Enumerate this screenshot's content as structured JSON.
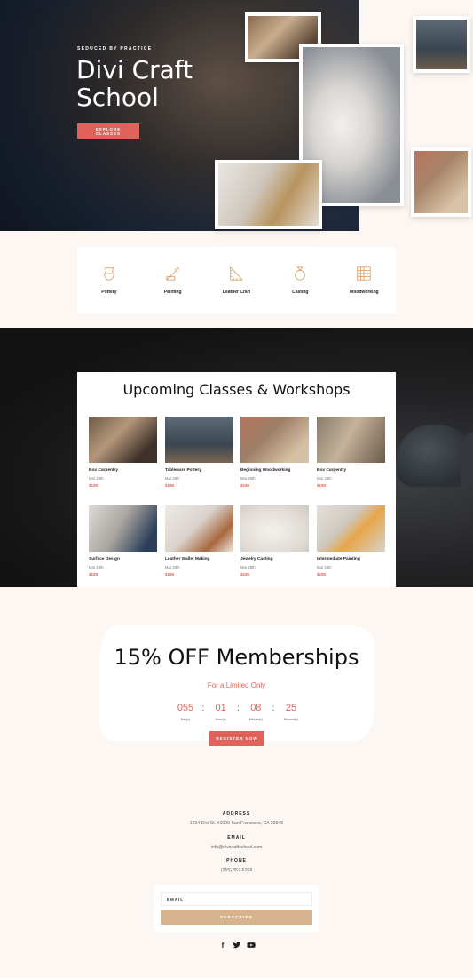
{
  "hero": {
    "kicker": "SEDUCED BY PRACTICE",
    "title": "Divi Craft School",
    "button": "EXPLORE CLASSES"
  },
  "categories": [
    {
      "label": "Pottery",
      "icon": "pot-icon"
    },
    {
      "label": "Painting",
      "icon": "paint-tools-icon"
    },
    {
      "label": "Leather Craft",
      "icon": "ruler-icon"
    },
    {
      "label": "Casting",
      "icon": "ring-icon"
    },
    {
      "label": "Woodworking",
      "icon": "wood-grid-icon"
    }
  ],
  "classes": {
    "title": "Upcoming Classes & Workshops",
    "items": [
      {
        "name": "Box Carpentry",
        "date": "Mar 28th",
        "price": "$180"
      },
      {
        "name": "Tableware Pottery",
        "date": "Mar 28th",
        "price": "$180"
      },
      {
        "name": "Beginning Woodworking",
        "date": "Mar 28th",
        "price": "$180"
      },
      {
        "name": "Box Carpentry",
        "date": "Mar 28th",
        "price": "$180"
      },
      {
        "name": "Surface Design",
        "date": "Mar 28th",
        "price": "$180"
      },
      {
        "name": "Leather Wallet Making",
        "date": "Mar 28th",
        "price": "$180"
      },
      {
        "name": "Jewelry Casting",
        "date": "Mar 28th",
        "price": "$180"
      },
      {
        "name": "Intermediate Painting",
        "date": "Mar 28th",
        "price": "$180"
      }
    ]
  },
  "promo": {
    "title": "15% OFF Memberships",
    "subtitle": "For a Limited Only",
    "timer": {
      "days": "055",
      "days_label": "Day(s)",
      "hours": "01",
      "hours_label": "Hour(s)",
      "minutes": "08",
      "minutes_label": "Minute(s)",
      "seconds": "25",
      "seconds_label": "Second(s)",
      "separator": ":"
    },
    "button": "REGISTER NOW"
  },
  "footer": {
    "address_label": "ADDRESS",
    "address": "1234 Divi St. #1000 San Francisco, CA 33945",
    "email_label": "EMAIL",
    "email": "info@divicraftschool.com",
    "phone_label": "PHONE",
    "phone": "(255) 352-6258",
    "email_field": "EMAIL",
    "subscribe": "SUBSCRIBE",
    "social": {
      "facebook": "f",
      "twitter": "t",
      "youtube": "▶"
    }
  },
  "colors": {
    "accent": "#e0625a",
    "gold": "#d7b48e",
    "cream": "#fcf7f3"
  }
}
